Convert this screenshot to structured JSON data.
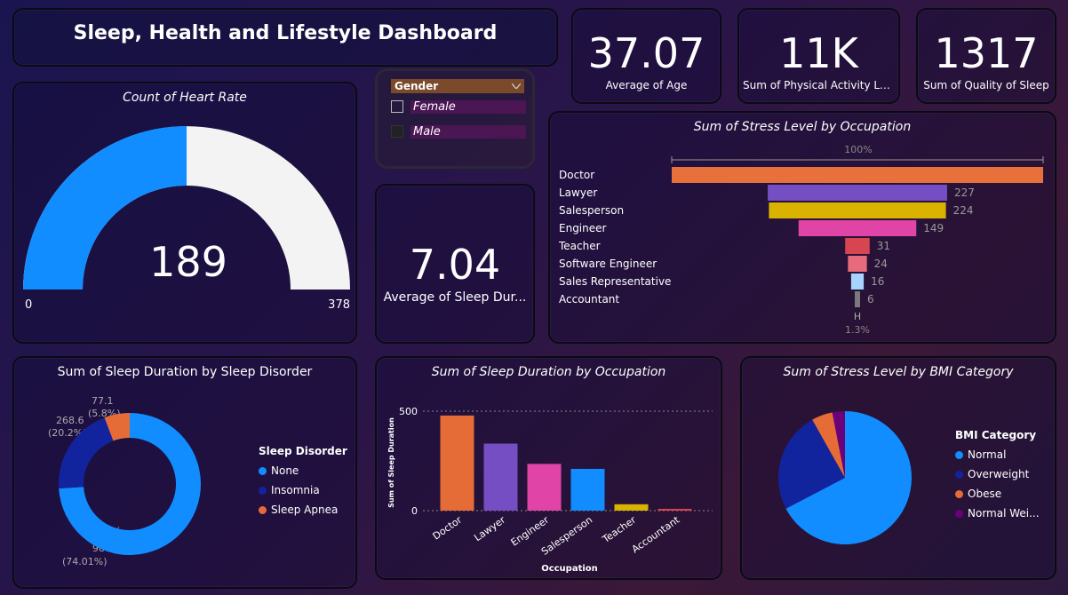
{
  "title": "Sleep, Health and Lifestyle Dashboard",
  "kpis": {
    "age": {
      "value": "37.07",
      "label": "Average of Age"
    },
    "activity": {
      "value": "11K",
      "label": "Sum of Physical Activity Le..."
    },
    "quality": {
      "value": "1317",
      "label": "Sum of Quality of Sleep"
    },
    "sleep_duration": {
      "value": "7.04",
      "label": "Average of Sleep Dur..."
    }
  },
  "gauge": {
    "title": "Count of Heart Rate",
    "value": "189",
    "min": "0",
    "max": "378",
    "fill_fraction": 0.5,
    "fill_color": "#118dff",
    "track_color": "#f3f3f3"
  },
  "slicer": {
    "header": "Gender",
    "options": [
      {
        "label": "Female",
        "checked": false
      },
      {
        "label": "Male",
        "checked": false
      }
    ]
  },
  "charts": {
    "funnel": {
      "title": "Sum of Stress Level by Occupation",
      "top_percent": "100%",
      "bottom_label": "H",
      "bottom_percent": "1.3%"
    },
    "donut": {
      "title": "Sum of Sleep Duration by Sleep Disorder",
      "legend_title": "Sleep Disorder",
      "labels": [
        {
          "value": "77.1",
          "pct": "(5.8%)"
        },
        {
          "value": "268.6",
          "pct": "(20.2%)"
        },
        {
          "value": "984.2",
          "pct": "(74.01%)"
        }
      ]
    },
    "bar": {
      "title": "Sum of Sleep Duration by Occupation",
      "xlabel": "Occupation",
      "ylabel": "Sum of Sleep Duration",
      "ticks": [
        "500",
        "0"
      ]
    },
    "pie": {
      "title": "Sum of Stress Level by BMI Category",
      "legend_title": "BMI Category"
    }
  },
  "chart_data": [
    {
      "type": "bar",
      "orientation": "funnel",
      "title": "Sum of Stress Level by Occupation",
      "categories": [
        "Doctor",
        "Lawyer",
        "Salesperson",
        "Engineer",
        "Teacher",
        "Software Engineer",
        "Sales Representative",
        "Accountant"
      ],
      "values": [
        470,
        227,
        224,
        149,
        31,
        24,
        16,
        6
      ],
      "data_labels": [
        "",
        "227",
        "224",
        "149",
        "31",
        "24",
        "16",
        "6"
      ],
      "colors": [
        "#e8703a",
        "#744ec2",
        "#d9b300",
        "#e044a7",
        "#d64550",
        "#e66c7b",
        "#a6d4ff",
        "#7a7a7a"
      ]
    },
    {
      "type": "pie",
      "subtype": "donut",
      "title": "Sum of Sleep Duration by Sleep Disorder",
      "categories": [
        "None",
        "Insomnia",
        "Sleep Apnea"
      ],
      "values": [
        984.2,
        268.6,
        77.1
      ],
      "colors": [
        "#118dff",
        "#12239e",
        "#e66c37"
      ]
    },
    {
      "type": "bar",
      "title": "Sum of Sleep Duration by Occupation",
      "xlabel": "Occupation",
      "ylabel": "Sum of Sleep Duration",
      "categories": [
        "Doctor",
        "Lawyer",
        "Engineer",
        "Salesperson",
        "Teacher",
        "Accountant"
      ],
      "values": [
        478,
        337,
        235,
        210,
        32,
        8
      ],
      "colors": [
        "#e66c37",
        "#744ec2",
        "#e044a7",
        "#118dff",
        "#d9b300",
        "#d64550"
      ],
      "ylim": [
        0,
        500
      ],
      "grid": true
    },
    {
      "type": "pie",
      "title": "Sum of Stress Level by BMI Category",
      "categories": [
        "Normal",
        "Overweight",
        "Obese",
        "Normal Wei..."
      ],
      "values": [
        66,
        24,
        5,
        3
      ],
      "colors": [
        "#118dff",
        "#12239e",
        "#e66c37",
        "#6b007b"
      ],
      "legend": "right"
    }
  ]
}
